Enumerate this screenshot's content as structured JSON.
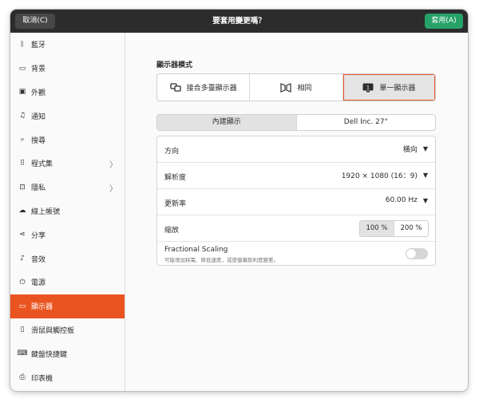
{
  "titlebar": {
    "cancel_label": "取消(C)",
    "title": "要套用變更嗎？",
    "apply_label": "套用(A)"
  },
  "colors": {
    "accent": "#e95420",
    "apply": "#26a269",
    "titlebar": "#2c2c2c"
  },
  "sidebar": {
    "items": [
      {
        "label": "藍牙",
        "icon": "bluetooth-icon",
        "glyph": "ᛒ"
      },
      {
        "label": "背景",
        "icon": "background-icon",
        "glyph": "▭"
      },
      {
        "label": "外觀",
        "icon": "appearance-icon",
        "glyph": "▣"
      },
      {
        "label": "通知",
        "icon": "bell-icon",
        "glyph": "♫"
      },
      {
        "label": "搜尋",
        "icon": "search-icon",
        "glyph": "⌕"
      },
      {
        "label": "程式集",
        "icon": "apps-grid-icon",
        "glyph": "⠿",
        "chevron": "〉"
      },
      {
        "label": "隱私",
        "icon": "lock-icon",
        "glyph": "⊡",
        "chevron": "〉"
      },
      {
        "label": "線上帳號",
        "icon": "cloud-icon",
        "glyph": "☁"
      },
      {
        "label": "分享",
        "icon": "share-icon",
        "glyph": "⋖"
      },
      {
        "label": "音效",
        "icon": "music-note-icon",
        "glyph": "♪"
      },
      {
        "label": "電源",
        "icon": "power-icon",
        "glyph": "⏻"
      },
      {
        "label": "顯示器",
        "icon": "display-icon",
        "glyph": "▭",
        "active": true
      },
      {
        "label": "滑鼠與觸控板",
        "icon": "mouse-icon",
        "glyph": "▯"
      },
      {
        "label": "鍵盤快捷鍵",
        "icon": "keyboard-icon",
        "glyph": "⌨"
      },
      {
        "label": "印表機",
        "icon": "printer-icon",
        "glyph": "⎙"
      }
    ]
  },
  "main": {
    "section_title": "顯示器模式",
    "modes": [
      {
        "label": "接合多臺顯示器",
        "icon": "join-displays-icon"
      },
      {
        "label": "相同",
        "icon": "mirror-icon"
      },
      {
        "label": "單一顯示器",
        "icon": "single-display-icon",
        "selected": true,
        "badge": "1"
      }
    ],
    "monitor_tabs": [
      {
        "label": "內建顯示",
        "selected": true
      },
      {
        "label": "Dell Inc. 27\""
      }
    ],
    "settings": {
      "orientation": {
        "label": "方向",
        "value": "橫向"
      },
      "resolution": {
        "label": "解析度",
        "value": "1920 × 1080 (16：9)"
      },
      "refresh_rate": {
        "label": "更新率",
        "value": "60.00 Hz"
      },
      "scale": {
        "label": "縮放",
        "options": [
          "100 %",
          "200 %"
        ],
        "selected_index": 0
      },
      "fractional": {
        "title": "Fractional Scaling",
        "subtitle": "可能增加耗電、降低速度，或使螢幕銳利度變差。",
        "enabled": false
      }
    }
  }
}
